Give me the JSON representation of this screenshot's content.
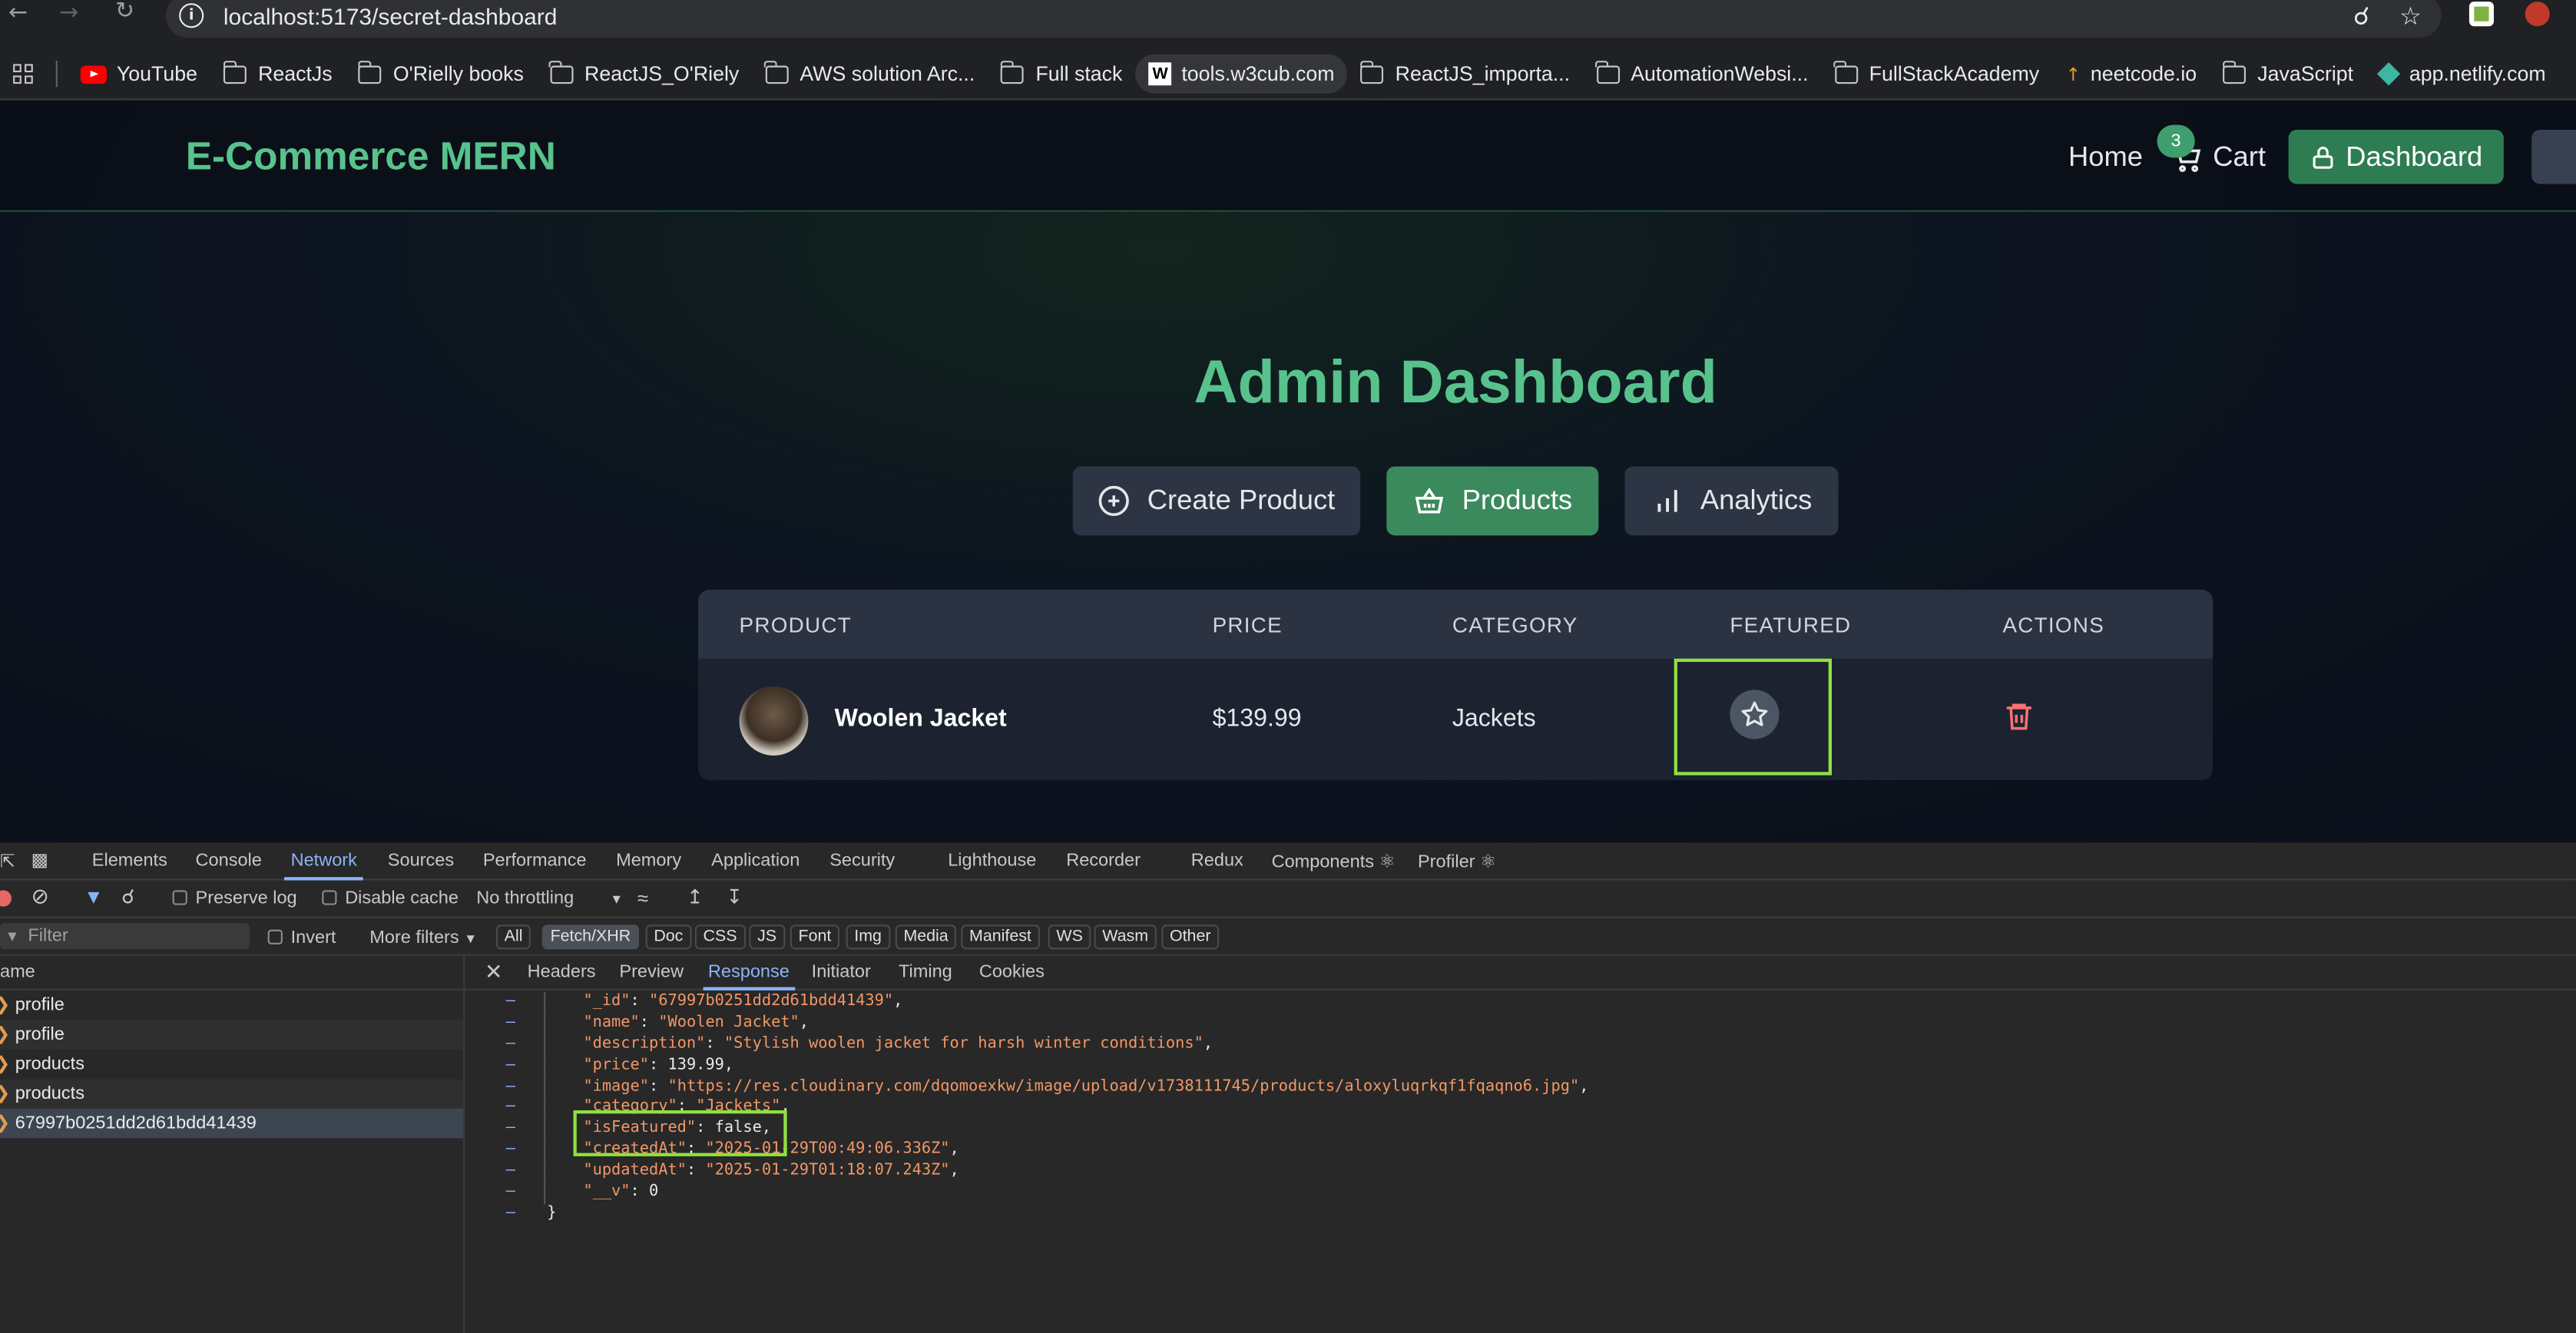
{
  "browser": {
    "url": "localhost:5173/secret-dashboard",
    "bookmarks": [
      {
        "label": "YouTube",
        "icon": "youtube-icon"
      },
      {
        "label": "ReactJs",
        "icon": "folder-icon"
      },
      {
        "label": "O'Rielly books",
        "icon": "folder-icon"
      },
      {
        "label": "ReactJS_O'Riely",
        "icon": "folder-icon"
      },
      {
        "label": "AWS solution Arc...",
        "icon": "folder-icon"
      },
      {
        "label": "Full stack",
        "icon": "folder-icon"
      },
      {
        "label": "tools.w3cub.com",
        "icon": "w3cub-icon"
      },
      {
        "label": "ReactJS_importa...",
        "icon": "folder-icon"
      },
      {
        "label": "AutomationWebsi...",
        "icon": "folder-icon"
      },
      {
        "label": "FullStackAcademy",
        "icon": "folder-icon"
      },
      {
        "label": "neetcode.io",
        "icon": "rocket-icon"
      },
      {
        "label": "JavaScript",
        "icon": "folder-icon"
      },
      {
        "label": "app.netlify.com",
        "icon": "netlify-icon"
      }
    ]
  },
  "app": {
    "brand": "E-Commerce MERN",
    "nav": {
      "home": "Home",
      "cart": "Cart",
      "cart_count": "3",
      "dashboard": "Dashboard"
    },
    "title": "Admin Dashboard",
    "tabs": [
      {
        "label": "Create Product",
        "icon": "plus-circle-icon"
      },
      {
        "label": "Products",
        "icon": "basket-icon"
      },
      {
        "label": "Analytics",
        "icon": "bar-chart-icon"
      }
    ],
    "table": {
      "headers": [
        "PRODUCT",
        "PRICE",
        "CATEGORY",
        "FEATURED",
        "ACTIONS"
      ],
      "rows": [
        {
          "name": "Woolen Jacket",
          "price": "$139.99",
          "category": "Jackets",
          "featured": false
        }
      ]
    },
    "colors": {
      "accent": "#58c28d",
      "button": "#3b8a5e",
      "highlight": "#8fe13f",
      "delete": "#f87171"
    }
  },
  "devtools": {
    "tabs": [
      "Elements",
      "Console",
      "Network",
      "Sources",
      "Performance",
      "Memory",
      "Application",
      "Security",
      "Lighthouse",
      "Recorder",
      "Redux",
      "Components ⚛",
      "Profiler ⚛"
    ],
    "active_tab": "Network",
    "toolbar": {
      "preserve_log": "Preserve log",
      "disable_cache": "Disable cache",
      "throttling": "No throttling"
    },
    "filter": {
      "placeholder": "Filter",
      "invert": "Invert",
      "more_filters": "More filters"
    },
    "filter_chips": [
      "All",
      "Fetch/XHR",
      "Doc",
      "CSS",
      "JS",
      "Font",
      "Img",
      "Media",
      "Manifest",
      "WS",
      "Wasm",
      "Other"
    ],
    "request_header": "ame",
    "requests": [
      "profile",
      "profile",
      "products",
      "products",
      "67997b0251dd2d61bdd41439"
    ],
    "detail_tabs": [
      "Headers",
      "Preview",
      "Response",
      "Initiator",
      "Timing",
      "Cookies"
    ],
    "response_lines": [
      "\"_id\": \"67997b0251dd2d61bdd41439\",",
      "\"name\": \"Woolen Jacket\",",
      "\"description\": \"Stylish woolen jacket for harsh winter conditions\",",
      "\"price\": 139.99,",
      "\"image\": \"https://res.cloudinary.com/dqomoexkw/image/upload/v1738111745/products/aloxyluqrkqf1fqaqno6.jpg\",",
      "\"category\": \"Jackets\",",
      "\"isFeatured\": false,",
      "\"createdAt\": \"2025-01-29T00:49:06.336Z\",",
      "\"updatedAt\": \"2025-01-29T01:18:07.243Z\",",
      "\"__v\": 0"
    ],
    "closing_brace": "}"
  }
}
